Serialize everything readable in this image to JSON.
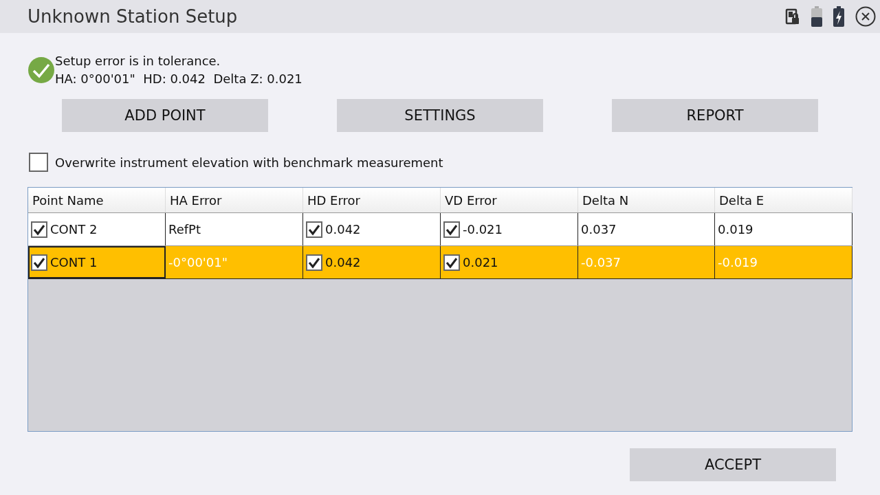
{
  "window": {
    "title": "Unknown Station Setup"
  },
  "status": {
    "ok": true,
    "message": "Setup error is in tolerance.",
    "details": "HA: 0°00'01\"  HD: 0.042  Delta Z: 0.021"
  },
  "buttons": [
    "ADD POINT",
    "SETTINGS",
    "REPORT"
  ],
  "overwrite_option": {
    "label": "Overwrite instrument elevation with benchmark measurement",
    "checked": false
  },
  "table": {
    "columns": [
      "Point Name",
      "HA Error",
      "HD Error",
      "VD Error",
      "Delta N",
      "Delta E"
    ],
    "rows": [
      {
        "selected": false,
        "cells": [
          {
            "kind": "check",
            "checked": true,
            "text": "CONT 2"
          },
          {
            "kind": "text",
            "text": "RefPt"
          },
          {
            "kind": "check",
            "checked": true,
            "text": "0.042"
          },
          {
            "kind": "check",
            "checked": true,
            "text": "-0.021"
          },
          {
            "kind": "text",
            "text": "0.037"
          },
          {
            "kind": "text",
            "text": "0.019"
          }
        ]
      },
      {
        "selected": true,
        "cells": [
          {
            "kind": "check",
            "checked": true,
            "text": "CONT 1"
          },
          {
            "kind": "text",
            "text": "-0°00'01\""
          },
          {
            "kind": "check",
            "checked": true,
            "text": "0.042"
          },
          {
            "kind": "check",
            "checked": true,
            "text": "0.021"
          },
          {
            "kind": "text",
            "text": "-0.037"
          },
          {
            "kind": "text",
            "text": "-0.019"
          }
        ]
      }
    ]
  },
  "accept_button": "ACCEPT"
}
